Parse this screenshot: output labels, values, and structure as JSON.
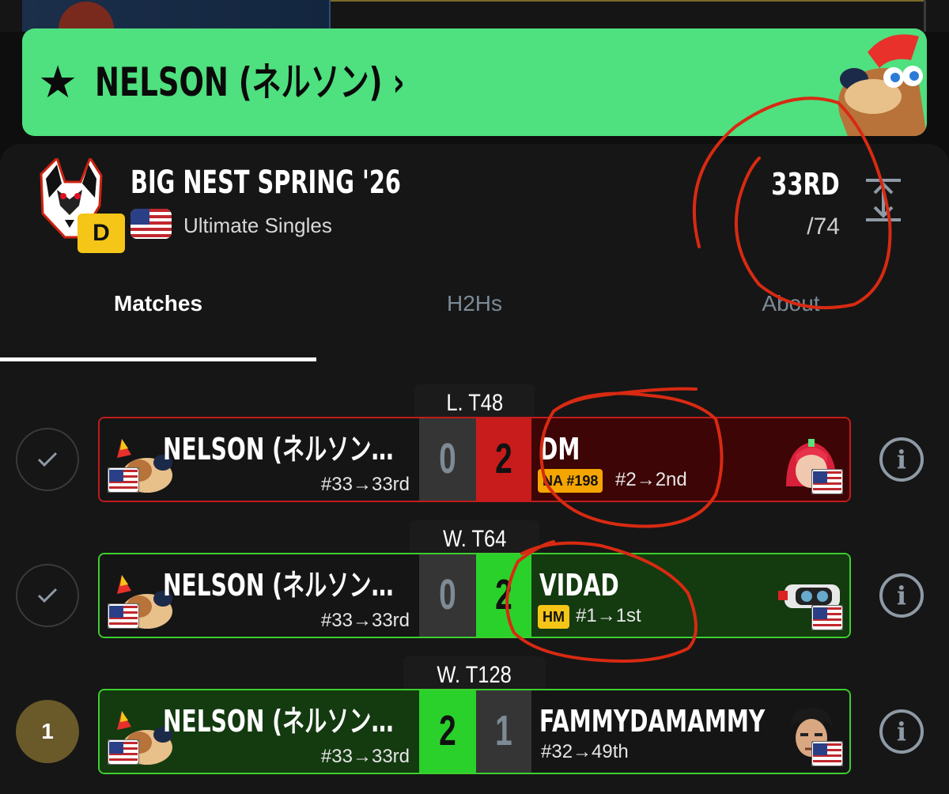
{
  "banner": {
    "text": "NELSON (ネルソン) ›",
    "star": "★"
  },
  "event": {
    "title": "BIG NEST SPRING '26",
    "tier": "D",
    "game": "Ultimate Singles",
    "placing": "33RD",
    "entrants": "/74"
  },
  "tabs": [
    {
      "label": "Matches",
      "active": true
    },
    {
      "label": "H2Hs",
      "active": false
    },
    {
      "label": "About",
      "active": false
    }
  ],
  "matches": [
    {
      "round": "L. T48",
      "status": "check",
      "p1": {
        "name": "NELSON (ネルソン…",
        "seed": "#33→33rd",
        "score": "0"
      },
      "p2": {
        "name": "DM",
        "badge": "NA #198",
        "seed": "#2→2nd",
        "score": "2"
      },
      "result": "loss"
    },
    {
      "round": "W. T64",
      "status": "check",
      "p1": {
        "name": "NELSON (ネルソン…",
        "seed": "#33→33rd",
        "score": "0"
      },
      "p2": {
        "name": "VIDAD",
        "badge": "HM",
        "seed": "#1→1st",
        "score": "2"
      },
      "result": "loss"
    },
    {
      "round": "W. T128",
      "status": "1",
      "p1": {
        "name": "NELSON (ネルソン…",
        "seed": "#33→33rd",
        "score": "2"
      },
      "p2": {
        "name": "FAMMYDAMAMMY",
        "seed": "#32→49th",
        "score": "1"
      },
      "result": "win"
    }
  ],
  "colors": {
    "banner": "#4fe07f",
    "win": "#2bd12b",
    "loss": "#c81c1c",
    "tier": "#f5c518"
  }
}
